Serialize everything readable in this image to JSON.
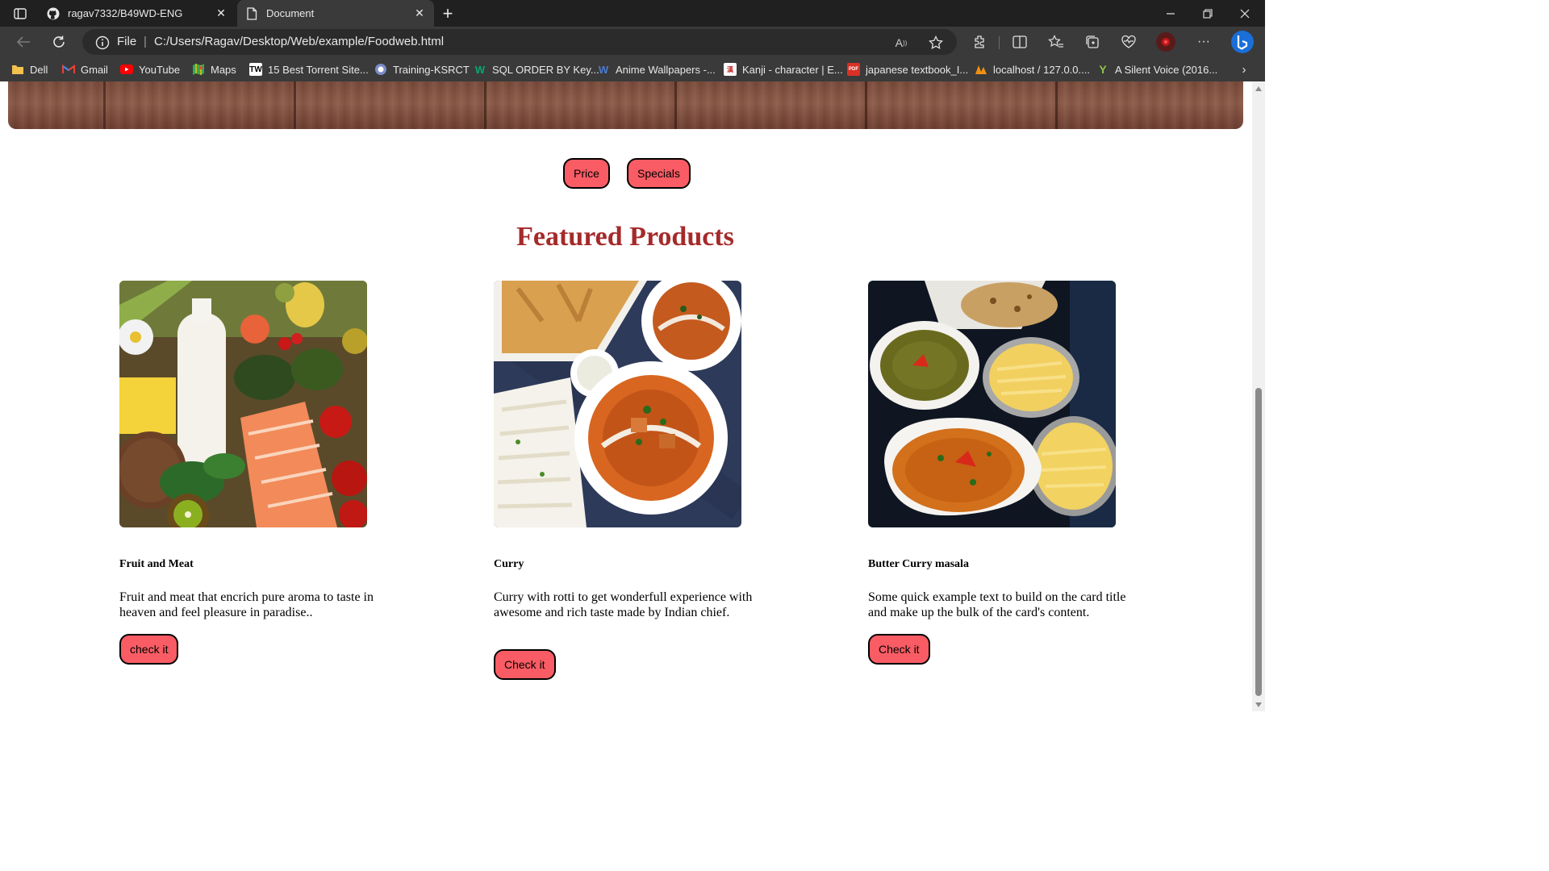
{
  "browser": {
    "tabs": [
      {
        "title": "ragav7332/B49WD-ENG",
        "icon": "github-icon"
      },
      {
        "title": "Document",
        "icon": "document-icon"
      }
    ],
    "address": {
      "scheme_label": "File",
      "url": "C:/Users/Ragav/Desktop/Web/example/Foodweb.html"
    },
    "bookmarks": [
      {
        "label": "Dell",
        "icon": "folder-icon",
        "color": "#f2c14e"
      },
      {
        "label": "Gmail",
        "icon": "gmail-icon",
        "color": "#ea4335"
      },
      {
        "label": "YouTube",
        "icon": "youtube-icon",
        "color": "#ff0000"
      },
      {
        "label": "Maps",
        "icon": "maps-icon",
        "color": "#34a853"
      },
      {
        "label": "15 Best Torrent Site...",
        "icon": "tw-icon",
        "color": "#ffffff"
      },
      {
        "label": "Training-KSRCT",
        "icon": "ksrct-icon",
        "color": "#7a8cc8"
      },
      {
        "label": "SQL ORDER BY Key...",
        "icon": "w3schools-icon",
        "color": "#04aa6d"
      },
      {
        "label": "Anime Wallpapers -...",
        "icon": "wallpapers-icon",
        "color": "#4a7bd0"
      },
      {
        "label": "Kanji - character | E...",
        "icon": "kanji-icon",
        "color": "#c02020"
      },
      {
        "label": "japanese textbook_I...",
        "icon": "pdf-icon",
        "color": "#d93025"
      },
      {
        "label": "localhost / 127.0.0....",
        "icon": "phpmyadmin-icon",
        "color": "#f29111"
      },
      {
        "label": "A Silent Voice (2016...",
        "icon": "y-icon",
        "color": "#8bc34a"
      }
    ]
  },
  "page": {
    "filters": [
      {
        "label": "Price"
      },
      {
        "label": "Specials"
      }
    ],
    "section_title": "Featured Products",
    "products": [
      {
        "title": "Fruit and Meat",
        "text": "Fruit and meat that encrich pure aroma to taste in heaven and feel pleasure in paradise..",
        "button": "check it"
      },
      {
        "title": "Curry",
        "text": "Curry with rotti to get wonderfull experience with awesome and rich taste made by Indian chief.",
        "button": "Check it"
      },
      {
        "title": "Butter Curry masala",
        "text": "Some quick example text to build on the card title and make up the bulk of the card's content.",
        "button": "Check it"
      }
    ]
  },
  "colors": {
    "button_fill": "#f95c64",
    "title_color": "#a52a2a",
    "chrome_dark": "#202020",
    "chrome_toolbar": "#3a3a3a"
  }
}
